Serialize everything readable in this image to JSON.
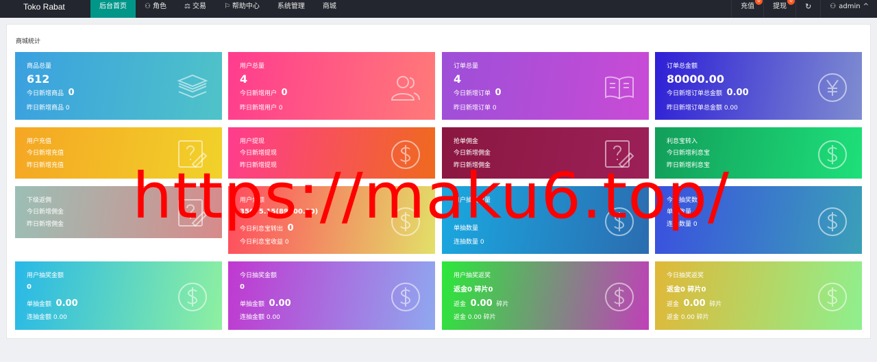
{
  "brand": "Toko Rabat",
  "nav": [
    {
      "label": "后台首页",
      "icon": ""
    },
    {
      "label": "角色",
      "icon": "user-icon"
    },
    {
      "label": "交易",
      "icon": "scale-icon"
    },
    {
      "label": "帮助中心",
      "icon": "flag-icon"
    },
    {
      "label": "系统管理",
      "icon": ""
    },
    {
      "label": "商城",
      "icon": ""
    }
  ],
  "right_nav": {
    "recharge": "充值",
    "recharge_badge": "0",
    "withdraw": "提现",
    "withdraw_badge": "0",
    "refresh_icon": "refresh-icon",
    "user": "admin"
  },
  "panel_title": "商城统计",
  "cards": [
    {
      "title": "商品总量",
      "big": "612",
      "l1": "今日新增商品",
      "l1v": "0",
      "l2": "昨日新增商品 0",
      "icon": "layers-icon",
      "colors": [
        "#3aa0e0",
        "#4fc3c8"
      ]
    },
    {
      "title": "用户总量",
      "big": "4",
      "l1": "今日新增用户",
      "l1v": "0",
      "l2": "昨日新增用户 0",
      "icon": "users-icon",
      "colors": [
        "#ff3c8e",
        "#ff7a78"
      ]
    },
    {
      "title": "订单总量",
      "big": "4",
      "l1": "今日新增订单",
      "l1v": "0",
      "l2": "昨日新增订单 0",
      "icon": "book-icon",
      "colors": [
        "#9d4fd8",
        "#c94bd6"
      ]
    },
    {
      "title": "订单总金额",
      "big": "80000.00",
      "l1": "今日新增订单总金额",
      "l1v": "0.00",
      "l2": "昨日新增订单总金额 0.00",
      "icon": "yen-icon",
      "colors": [
        "#2e1fd6",
        "#7f8dd0"
      ]
    },
    {
      "title": "用户充值",
      "big": "",
      "l1": "今日新增充值",
      "l1v": "",
      "l2": "昨日新增充值",
      "icon": "edit-doc-icon",
      "colors": [
        "#f5a623",
        "#f1d22a"
      ]
    },
    {
      "title": "用户提现",
      "big": "",
      "l1": "今日新增提现",
      "l1v": "",
      "l2": "昨日新增提现",
      "icon": "dollar-icon",
      "colors": [
        "#ff3c8e",
        "#ef6a1e"
      ]
    },
    {
      "title": "抢单佣金",
      "big": "",
      "l1": "今日新增佣金",
      "l1v": "",
      "l2": "昨日新增佣金",
      "icon": "edit-doc-icon",
      "colors": [
        "#8a1740",
        "#9c2058"
      ]
    },
    {
      "title": "利息宝转入",
      "big": "",
      "l1": "今日新增利息宝",
      "l1v": "",
      "l2": "昨日新增利息宝",
      "icon": "dollar-icon",
      "colors": [
        "#129e5a",
        "#1ee07a"
      ]
    },
    {
      "title": "下级返佣",
      "big": "",
      "l1": "今日新增佣金",
      "l1v": "",
      "l2": "昨日新增佣金",
      "icon": "edit-doc-icon",
      "colors": [
        "#9bbfb5",
        "#d78a8a"
      ]
    },
    {
      "title": "用户余额",
      "big": "35675.15(89300.00)",
      "l1": "今日利息宝转出",
      "l1v": "0",
      "l2": "今日利息宝收益 0",
      "icon": "dollar-icon",
      "colors": [
        "#ff4a5e",
        "#e2e068"
      ]
    },
    {
      "title": "用户抽奖数量",
      "big": "0",
      "l1": "单抽数量",
      "l1v": "",
      "l2": "连抽数量 0",
      "icon": "dollar-icon",
      "colors": [
        "#1aa8e0",
        "#2b6cb0"
      ]
    },
    {
      "title": "今日抽奖数量",
      "big": "",
      "l1": "单抽数量",
      "l1v": "",
      "l2": "连抽数量 0",
      "icon": "dollar-icon",
      "colors": [
        "#3a4fe0",
        "#3aa0b8"
      ]
    },
    {
      "title": "用户抽奖金额",
      "big": "0",
      "l1": "单抽金额",
      "l1v": "0.00",
      "l2": "连抽金额 0.00",
      "icon": "dollar-icon",
      "colors": [
        "#28b8e8",
        "#8ef0a0"
      ]
    },
    {
      "title": "今日抽奖金额",
      "big": "0",
      "l1": "单抽金额",
      "l1v": "0.00",
      "l2": "连抽金额 0.00",
      "icon": "dollar-icon",
      "colors": [
        "#c038d0",
        "#8fa8ef"
      ]
    },
    {
      "title": "用户抽奖返奖",
      "big": "返金0 碎片0",
      "l1": "返金",
      "l1v": "0.00",
      "l1s": "碎片",
      "l2": "返金 0.00 碎片",
      "icon": "dollar-icon",
      "colors": [
        "#2be83a",
        "#c040b8"
      ]
    },
    {
      "title": "今日抽奖返奖",
      "big": "返金0 碎片0",
      "l1": "返金",
      "l1v": "0.00",
      "l1s": "碎片",
      "l2": "返金 0.00 碎片",
      "icon": "dollar-icon",
      "colors": [
        "#e0b838",
        "#8ef08e"
      ]
    }
  ],
  "watermark": "https://maku6.top/"
}
